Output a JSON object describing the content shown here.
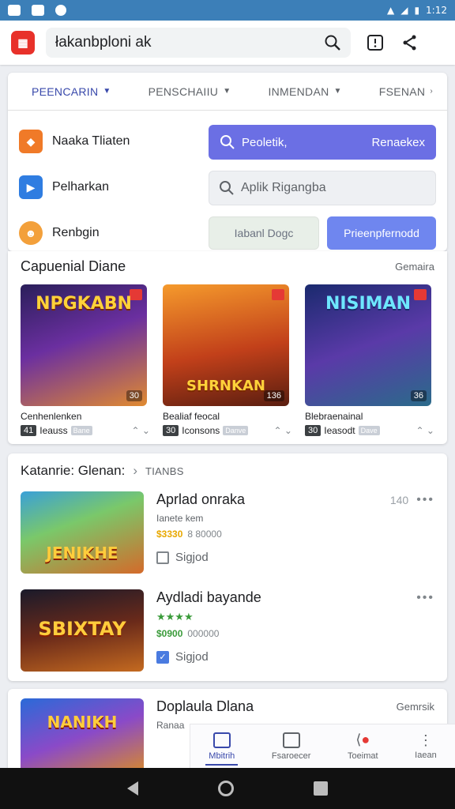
{
  "status": {
    "time": "1:12"
  },
  "header": {
    "search_value": "łakanbploni ak"
  },
  "tabs": [
    {
      "label": "PEENCARIN"
    },
    {
      "label": "PENSCHAIIU"
    },
    {
      "label": "INMENDAN"
    },
    {
      "label": "FSENAN"
    }
  ],
  "categories": [
    {
      "label": "Naaka Tliaten",
      "color": "#f07a28"
    },
    {
      "label": "Pelharkan",
      "color": "#2f7de1"
    },
    {
      "label": "Renbgin",
      "color": "#f3a03b"
    }
  ],
  "filters": {
    "primary_placeholder": "Peoletik,",
    "primary_action": "Renaekex",
    "secondary_placeholder": "Aplik Rigangba",
    "ghost_button": "Iabanl Dogc",
    "blue_button": "Prieenpfernodd"
  },
  "featured": {
    "title": "Capuenial Diane",
    "more": "Gemaira",
    "games": [
      {
        "art": "NPGKABN",
        "badge": "30",
        "name": "Cenhenlenken",
        "rank": "41",
        "meta": "Ieauss",
        "tag": "Bane"
      },
      {
        "art": "SHRNKAN",
        "badge": "136",
        "name": "Bealiaf feocal",
        "rank": "30",
        "meta": "Iconsons",
        "tag": "Danve"
      },
      {
        "art": "NISIMAN",
        "badge": "36",
        "name": "Blebraenainal",
        "rank": "30",
        "meta": "Ieasodt",
        "tag": "Dave"
      }
    ]
  },
  "list": {
    "title": "Katanrie: Glenan:",
    "sub": "TIANBS",
    "apps": [
      {
        "art": "JENIKHE",
        "title": "Aprlad onraka",
        "count": "140",
        "sub": "Ianete kem",
        "price": "$3330",
        "price_extra": "8 80000",
        "check": "Sigjod",
        "checked": false
      },
      {
        "art": "SBIXTAY",
        "title": "Aydladi bayande",
        "count": "",
        "sub": "",
        "stars": "★★★★",
        "price": "$0900",
        "price_extra": "000000",
        "check": "Sigjod",
        "checked": true
      }
    ]
  },
  "third": {
    "art": "NANIKH",
    "title": "Doplaula Dlana",
    "more": "Gemrsik",
    "sub": "Ranaa"
  },
  "bottom_nav": [
    {
      "label": "Mbitrih"
    },
    {
      "label": "Fsaroecer"
    },
    {
      "label": "Toeimat"
    },
    {
      "label": "Iaean"
    }
  ]
}
